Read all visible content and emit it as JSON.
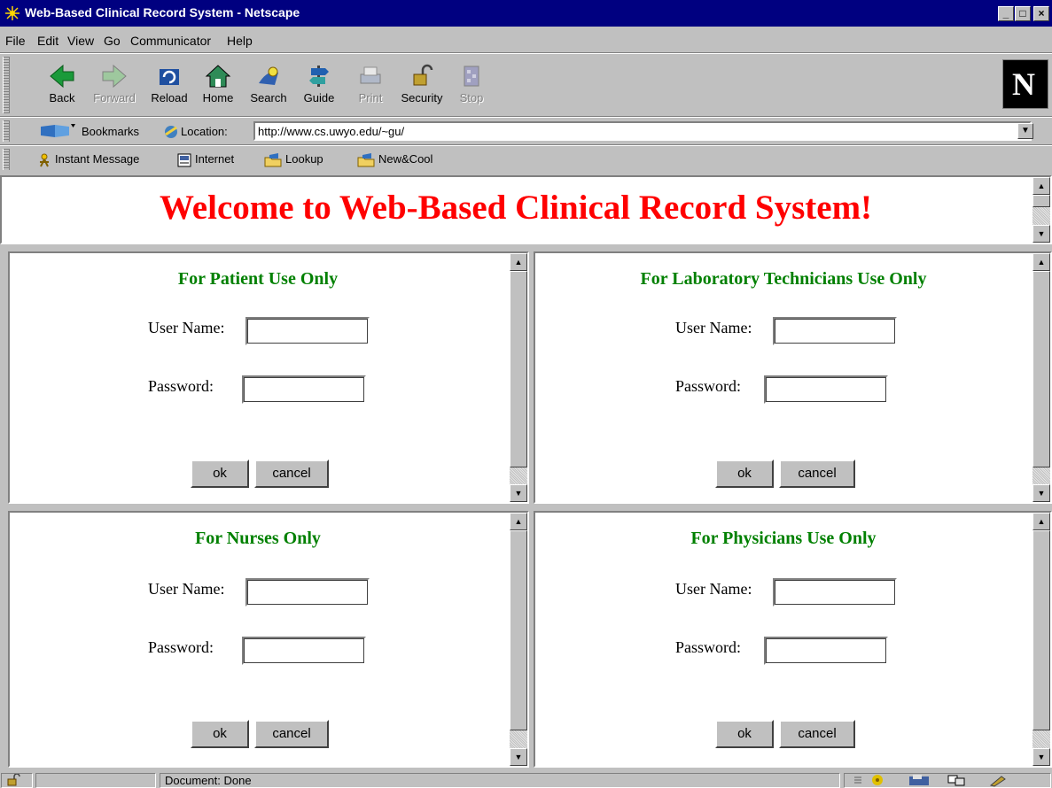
{
  "window": {
    "title": "Web-Based Clinical Record System - Netscape",
    "controls": {
      "minimize": "_",
      "maximize": "□",
      "close": "×"
    }
  },
  "menu": [
    "File",
    "Edit",
    "View",
    "Go",
    "Communicator",
    "Help"
  ],
  "toolbar": {
    "buttons": [
      {
        "label": "Back",
        "icon": "back-arrow-icon",
        "enabled": true
      },
      {
        "label": "Forward",
        "icon": "forward-arrow-icon",
        "enabled": false
      },
      {
        "label": "Reload",
        "icon": "reload-icon",
        "enabled": true
      },
      {
        "label": "Home",
        "icon": "home-icon",
        "enabled": true
      },
      {
        "label": "Search",
        "icon": "search-icon",
        "enabled": true
      },
      {
        "label": "Guide",
        "icon": "guide-icon",
        "enabled": true
      },
      {
        "label": "Print",
        "icon": "print-icon",
        "enabled": false
      },
      {
        "label": "Security",
        "icon": "padlock-icon",
        "enabled": true
      },
      {
        "label": "Stop",
        "icon": "stop-icon",
        "enabled": false
      }
    ],
    "logo": "N"
  },
  "location": {
    "bookmarks_label": "Bookmarks",
    "location_label": "Location:",
    "url": "http://www.cs.uwyo.edu/~gu/"
  },
  "personal_toolbar": [
    "Instant Message",
    "Internet",
    "Lookup",
    "New&Cool"
  ],
  "page": {
    "welcome": "Welcome to Web-Based Clinical Record System!",
    "panels": [
      {
        "title": "For Patient Use Only",
        "username_label": "User Name:",
        "password_label": "Password:",
        "ok": "ok",
        "cancel": "cancel"
      },
      {
        "title": "For Laboratory Technicians Use Only",
        "username_label": "User Name:",
        "password_label": "Password:",
        "ok": "ok",
        "cancel": "cancel"
      },
      {
        "title": "For Nurses Only",
        "username_label": "User Name:",
        "password_label": "Password:",
        "ok": "ok",
        "cancel": "cancel"
      },
      {
        "title": "For Physicians Use Only",
        "username_label": "User Name:",
        "password_label": "Password:",
        "ok": "ok",
        "cancel": "cancel"
      }
    ]
  },
  "status": {
    "text": "Document: Done"
  },
  "colors": {
    "title_bar": "#000080",
    "welcome": "#ff0000",
    "panel_title": "#008000",
    "chrome": "#c0c0c0"
  }
}
